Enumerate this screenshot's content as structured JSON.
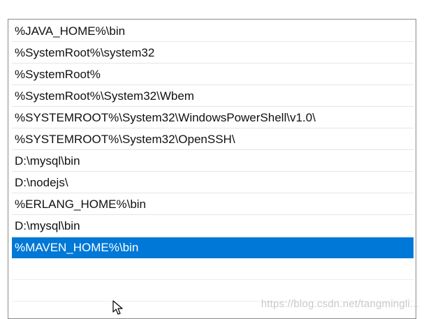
{
  "path_list": {
    "items": [
      "%JAVA_HOME%\\bin",
      "%SystemRoot%\\system32",
      "%SystemRoot%",
      "%SystemRoot%\\System32\\Wbem",
      "%SYSTEMROOT%\\System32\\WindowsPowerShell\\v1.0\\",
      "%SYSTEMROOT%\\System32\\OpenSSH\\",
      "D:\\mysql\\bin",
      "D:\\nodejs\\",
      "%ERLANG_HOME%\\bin",
      "D:\\mysql\\bin",
      "%MAVEN_HOME%\\bin",
      "",
      ""
    ],
    "selected_index": 10
  },
  "watermark": "https://blog.csdn.net/tangmingli...",
  "colors": {
    "selection": "#0078d7",
    "border": "#8a8a8a"
  },
  "icons": {
    "cursor": "mouse-pointer-icon"
  }
}
